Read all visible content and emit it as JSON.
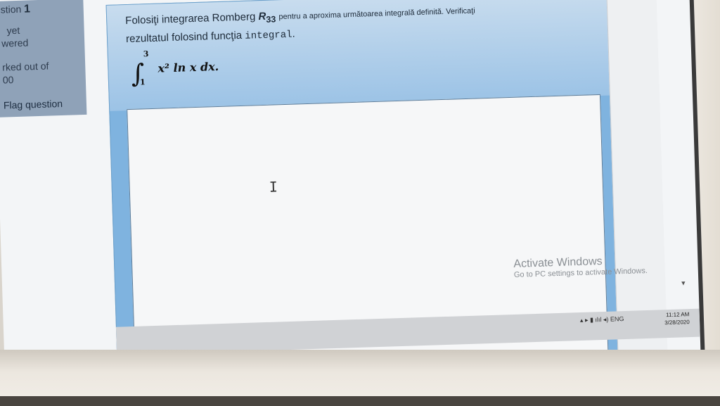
{
  "sidebar": {
    "question_label": "stion",
    "question_number": "1",
    "status_line1": "yet",
    "status_line2": "wered",
    "marks_line1": "rked out of",
    "marks_line2": "00",
    "flag_label": "Flag question"
  },
  "question": {
    "text_part1": "Folosiţi integrarea Romberg",
    "symbol": "R",
    "symbol_sub": "33",
    "text_part2": "pentru a aproxima următoarea integrală definită. Verificaţi",
    "text_line2": "rezultatul folosind funcţia",
    "function_name": "integral",
    "text_end": ".",
    "integral_upper": "3",
    "integral_lower": "1",
    "integrand": "x² ln x dx."
  },
  "answer_box": {
    "cursor_glyph": "I"
  },
  "watermark": {
    "line1": "Activate Windows",
    "line2": "Go to PC settings to activate Windows."
  },
  "taskbar": {
    "language": "ENG",
    "time": "11:12 AM",
    "date": "3/28/2020"
  }
}
